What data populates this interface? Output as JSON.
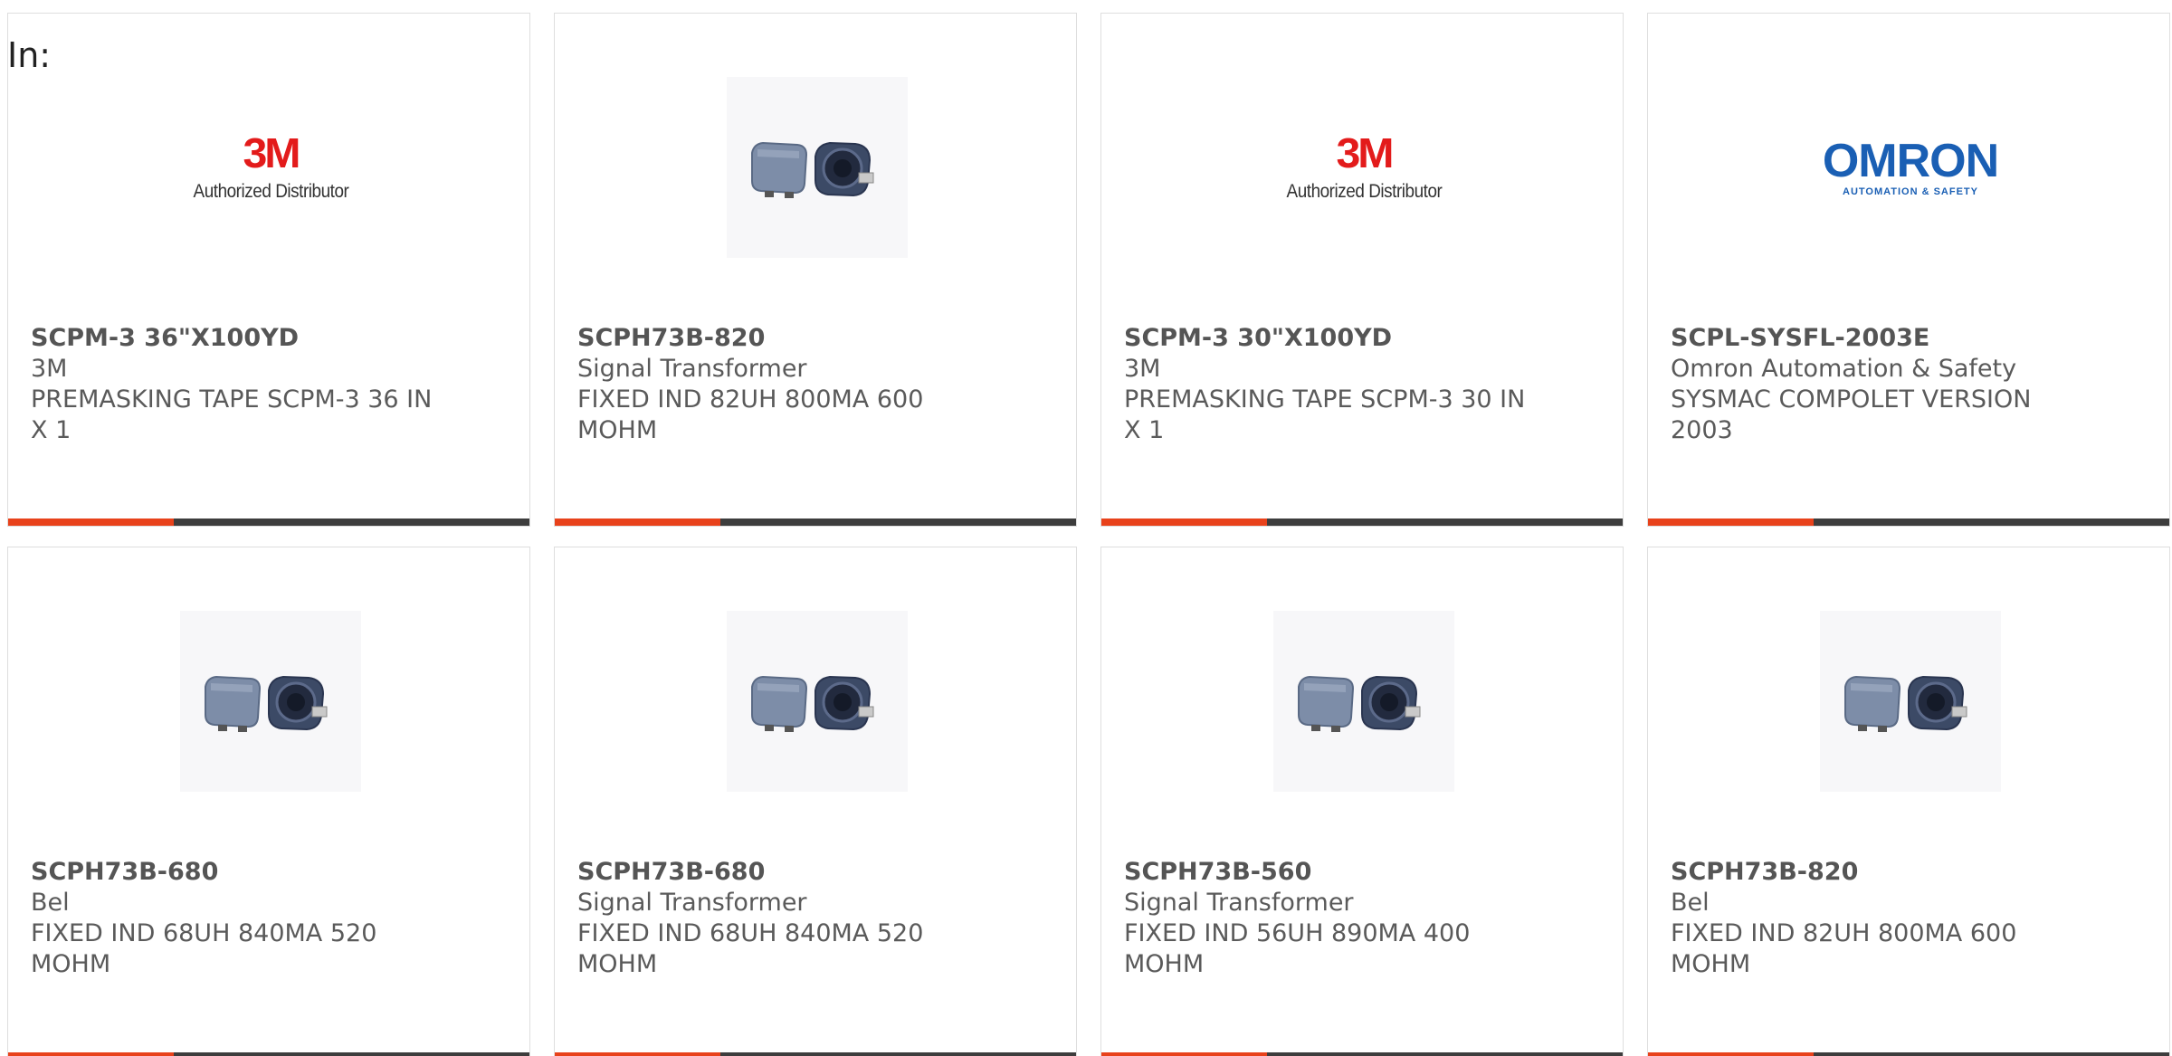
{
  "filter_label": "In:",
  "colors": {
    "accent": "#e8421b",
    "bar": "#3d3d3d",
    "text": "#5a5a5a",
    "border": "#dedede"
  },
  "cards": [
    {
      "part_number": "SCPM-3 36\"X100YD",
      "manufacturer": "3M",
      "description": "PREMASKING TAPE SCPM-3 36 IN X 1",
      "image": "3m-logo",
      "logo_mark": "3M",
      "logo_sub": "Authorized Distributor"
    },
    {
      "part_number": "SCPH73B-820",
      "manufacturer": "Signal Transformer",
      "description": "FIXED IND 82UH 800MA 600 MOHM",
      "image": "inductor-photo"
    },
    {
      "part_number": "SCPM-3 30\"X100YD",
      "manufacturer": "3M",
      "description": "PREMASKING TAPE SCPM-3 30 IN X 1",
      "image": "3m-logo",
      "logo_mark": "3M",
      "logo_sub": "Authorized Distributor"
    },
    {
      "part_number": "SCPL-SYSFL-2003E",
      "manufacturer": "Omron Automation & Safety",
      "description": "SYSMAC COMPOLET VERSION 2003",
      "image": "omron-logo",
      "logo_mark": "OMRON",
      "logo_sub": "AUTOMATION & SAFETY"
    },
    {
      "part_number": "SCPH73B-680",
      "manufacturer": "Bel",
      "description": "FIXED IND 68UH 840MA 520 MOHM",
      "image": "inductor-photo"
    },
    {
      "part_number": "SCPH73B-680",
      "manufacturer": "Signal Transformer",
      "description": "FIXED IND 68UH 840MA 520 MOHM",
      "image": "inductor-photo"
    },
    {
      "part_number": "SCPH73B-560",
      "manufacturer": "Signal Transformer",
      "description": "FIXED IND 56UH 890MA 400 MOHM",
      "image": "inductor-photo"
    },
    {
      "part_number": "SCPH73B-820",
      "manufacturer": "Bel",
      "description": "FIXED IND 82UH 800MA 600 MOHM",
      "image": "inductor-photo"
    }
  ]
}
